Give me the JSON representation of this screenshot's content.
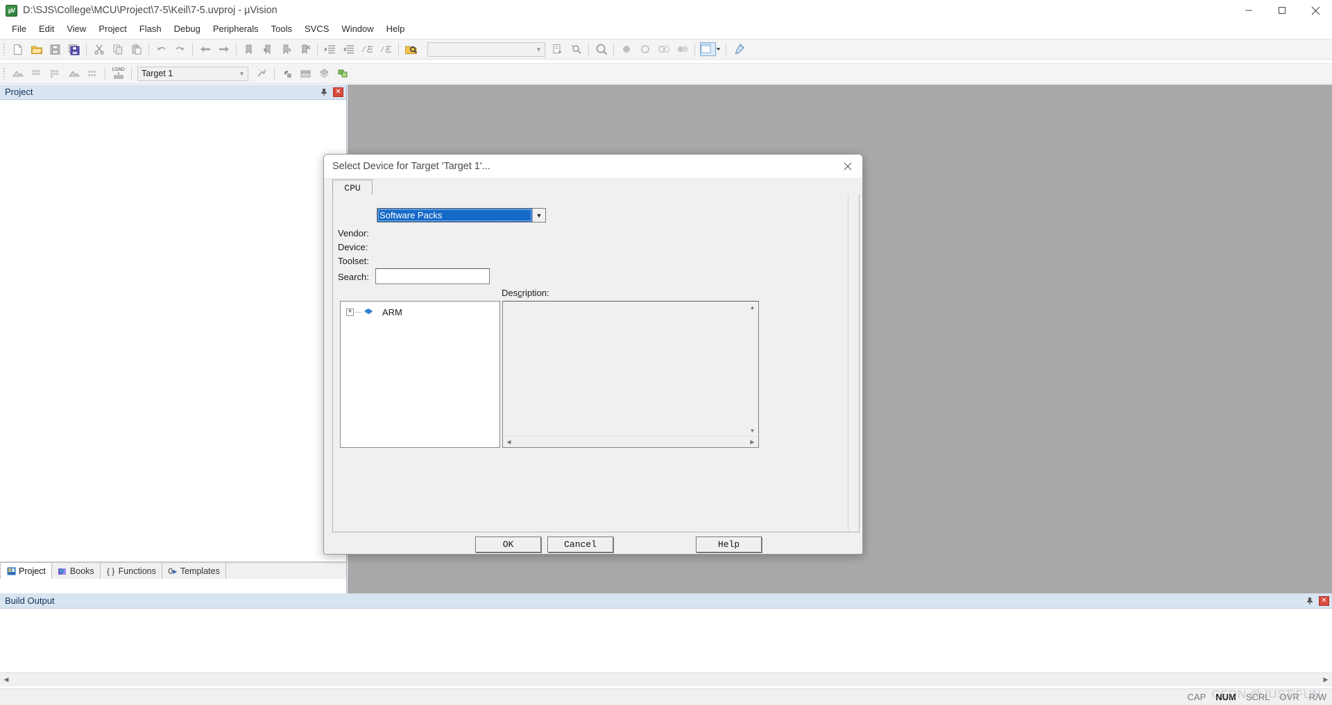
{
  "window": {
    "title": "D:\\SJS\\College\\MCU\\Project\\7-5\\Keil\\7-5.uvproj - µVision",
    "app_icon": "uvision-icon",
    "minimize_label": "Minimize",
    "maximize_label": "Maximize",
    "close_label": "Close"
  },
  "menu": {
    "items": [
      {
        "label": "File"
      },
      {
        "label": "Edit"
      },
      {
        "label": "View"
      },
      {
        "label": "Project"
      },
      {
        "label": "Flash"
      },
      {
        "label": "Debug"
      },
      {
        "label": "Peripherals"
      },
      {
        "label": "Tools"
      },
      {
        "label": "SVCS"
      },
      {
        "label": "Window"
      },
      {
        "label": "Help"
      }
    ]
  },
  "toolbar_main": {
    "items": [
      {
        "icon": "new-file-icon",
        "label": "New"
      },
      {
        "icon": "open-folder-icon",
        "label": "Open"
      },
      {
        "icon": "save-icon",
        "label": "Save"
      },
      {
        "icon": "save-all-icon",
        "label": "Save All"
      },
      {
        "icon": "cut-icon",
        "label": "Cut"
      },
      {
        "icon": "copy-icon",
        "label": "Copy"
      },
      {
        "icon": "paste-icon",
        "label": "Paste"
      },
      {
        "icon": "undo-icon",
        "label": "Undo"
      },
      {
        "icon": "redo-icon",
        "label": "Redo"
      },
      {
        "icon": "navigate-back-icon",
        "label": "Back"
      },
      {
        "icon": "navigate-forward-icon",
        "label": "Forward"
      },
      {
        "icon": "bookmark-toggle-icon",
        "label": "Insert/Remove Bookmark"
      },
      {
        "icon": "bookmark-prev-icon",
        "label": "Previous Bookmark"
      },
      {
        "icon": "bookmark-next-icon",
        "label": "Next Bookmark"
      },
      {
        "icon": "bookmark-clear-icon",
        "label": "Clear All Bookmarks"
      },
      {
        "icon": "indent-increase-icon",
        "label": "Indent Selection"
      },
      {
        "icon": "indent-decrease-icon",
        "label": "Unindent Selection"
      },
      {
        "icon": "comment-icon",
        "label": "Comment Selection"
      },
      {
        "icon": "uncomment-icon",
        "label": "Uncomment Selection"
      },
      {
        "icon": "find-in-files-icon",
        "label": "Find in Files"
      }
    ],
    "search_box_value": "",
    "trailing": [
      {
        "icon": "find-next-icon",
        "label": "Find Next"
      },
      {
        "icon": "incremental-find-icon",
        "label": "Incremental Find"
      },
      {
        "icon": "magnifier-icon",
        "label": "Find"
      },
      {
        "icon": "breakpoint-icon",
        "label": "Insert/Remove Breakpoint"
      },
      {
        "icon": "breakpoint-disable-icon",
        "label": "Enable/Disable Breakpoint"
      },
      {
        "icon": "breakpoint-disable-all-icon",
        "label": "Disable All Breakpoints"
      },
      {
        "icon": "breakpoint-kill-all-icon",
        "label": "Kill All Breakpoints"
      },
      {
        "icon": "window-layout-icon",
        "label": "Manage Window Layout"
      },
      {
        "icon": "configuration-wizard-icon",
        "label": "Configuration Wizard"
      }
    ]
  },
  "toolbar_build": {
    "items": [
      {
        "icon": "translate-icon",
        "label": "Translate"
      },
      {
        "icon": "build-icon",
        "label": "Build"
      },
      {
        "icon": "rebuild-icon",
        "label": "Rebuild"
      },
      {
        "icon": "batch-build-icon",
        "label": "Batch Build"
      },
      {
        "icon": "stop-build-icon",
        "label": "Stop Build"
      }
    ],
    "load_label": "LOAD",
    "load_icon": "download-to-flash-icon",
    "target_combo": {
      "value": "Target 1",
      "arrow_icon": "chevron-down-icon"
    },
    "trailing": [
      {
        "icon": "target-options-icon",
        "label": "Options for Target"
      },
      {
        "icon": "manage-runtime-icon",
        "label": "Manage Run-Time Environment"
      },
      {
        "icon": "pack-installer-icon",
        "label": "Pack Installer"
      },
      {
        "icon": "multi-project-icon",
        "label": "Manage Multi-Project"
      },
      {
        "icon": "project-components-icon",
        "label": "Manage Project Items"
      }
    ]
  },
  "project_panel": {
    "title": "Project",
    "pin_icon": "pin-icon",
    "close_icon": "close-icon",
    "tabs": [
      {
        "label": "Project",
        "icon": "project-tab-icon",
        "active": true
      },
      {
        "label": "Books",
        "icon": "books-tab-icon",
        "active": false
      },
      {
        "label": "Functions",
        "icon": "functions-tab-icon",
        "active": false
      },
      {
        "label": "Templates",
        "icon": "templates-tab-icon",
        "active": false
      }
    ]
  },
  "build_output": {
    "title": "Build Output",
    "pin_icon": "pin-icon",
    "close_icon": "close-icon",
    "content": "",
    "scroll_left_icon": "arrow-left-icon",
    "scroll_right_icon": "arrow-right-icon"
  },
  "status_bar": {
    "message": "",
    "flags": [
      {
        "label": "CAP",
        "active": false
      },
      {
        "label": "NUM",
        "active": true
      },
      {
        "label": "SCRL",
        "active": false
      },
      {
        "label": "OVR",
        "active": false
      },
      {
        "label": "R/W",
        "active": false
      }
    ],
    "watermark": "CSDN @JUSTiFUN"
  },
  "dialog": {
    "title": "Select Device for Target 'Target 1'...",
    "close_icon": "close-icon",
    "tab_label": "CPU",
    "packs_combo": {
      "value": "Software Packs",
      "arrow_icon": "chevron-down-icon"
    },
    "fields": [
      {
        "label": "Vendor:",
        "value": ""
      },
      {
        "label": "Device:",
        "value": ""
      },
      {
        "label": "Toolset:",
        "value": ""
      }
    ],
    "search": {
      "label": "Search:",
      "value": "",
      "placeholder": ""
    },
    "description_label_pre": "Des",
    "description_label_mnemonic": "c",
    "description_label_post": "ription:",
    "description_text": "",
    "tree": {
      "items": [
        {
          "label": "ARM",
          "expander": "+",
          "icon": "device-pack-icon"
        }
      ]
    },
    "scroll": {
      "up_icon": "arrow-up-icon",
      "down_icon": "arrow-down-icon",
      "left_icon": "arrow-left-icon",
      "right_icon": "arrow-right-icon"
    },
    "buttons": {
      "ok": "OK",
      "cancel": "Cancel",
      "help": "Help"
    }
  },
  "colors": {
    "panel_header": "#d8e4f0",
    "selection_blue": "#1569c7",
    "mdi_background": "#a9a9a9",
    "dialog_face": "#f0f0f0",
    "close_red": "#d94a3d"
  }
}
